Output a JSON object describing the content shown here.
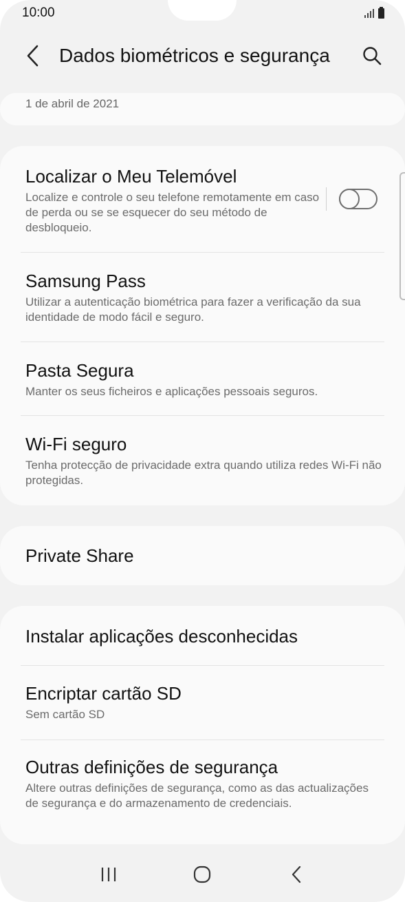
{
  "status_bar": {
    "time": "10:00"
  },
  "app_bar": {
    "title": "Dados biométricos e segurança"
  },
  "top_card": {
    "date": "1 de abril de 2021"
  },
  "section_1": {
    "items": [
      {
        "title": "Localizar o Meu Telemóvel",
        "subtitle": "Localize e controle o seu telefone remotamente em caso de perda ou se se esquecer do seu método de desbloqueio.",
        "toggle_on": false
      },
      {
        "title": "Samsung Pass",
        "subtitle": "Utilizar a autenticação biométrica para fazer a verificação da sua identidade de modo fácil e seguro."
      },
      {
        "title": "Pasta Segura",
        "subtitle": "Manter os seus ficheiros e aplicações pessoais seguros."
      },
      {
        "title": "Wi-Fi seguro",
        "subtitle": "Tenha protecção de privacidade extra quando utiliza redes Wi-Fi não protegidas."
      }
    ]
  },
  "section_2": {
    "items": [
      {
        "title": "Private Share"
      }
    ]
  },
  "section_3": {
    "items": [
      {
        "title": "Instalar aplicações desconhecidas"
      },
      {
        "title": "Encriptar cartão SD",
        "subtitle": "Sem cartão SD"
      },
      {
        "title": "Outras definições de segurança",
        "subtitle": "Altere outras definições de segurança, como as das actualizações de segurança e do armazenamento de credenciais."
      }
    ]
  },
  "nav_bar": {
    "icons": [
      "recents-icon",
      "home-icon",
      "back-icon"
    ]
  }
}
